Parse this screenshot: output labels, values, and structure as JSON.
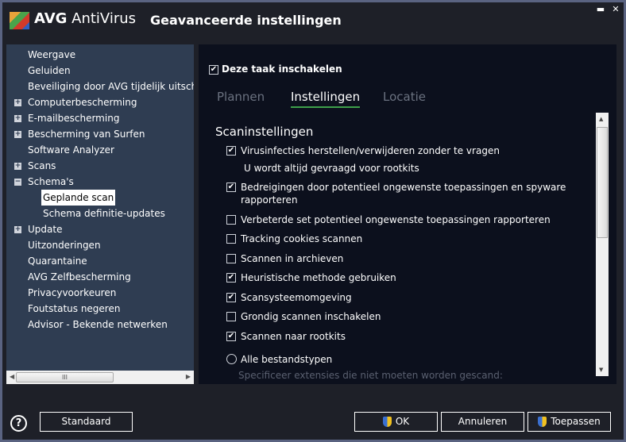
{
  "window": {
    "brand_bold": "AVG",
    "brand": " AntiVirus",
    "title": "Geavanceerde instellingen",
    "minimize": "▬",
    "close": "✕"
  },
  "sidebar": {
    "items": [
      {
        "label": "Weergave"
      },
      {
        "label": "Geluiden"
      },
      {
        "label": "Beveiliging door AVG tijdelijk uitschakelen"
      },
      {
        "label": "Computerbescherming",
        "expander": "+"
      },
      {
        "label": "E-mailbescherming",
        "expander": "+"
      },
      {
        "label": "Bescherming van Surfen",
        "expander": "+"
      },
      {
        "label": "Software Analyzer"
      },
      {
        "label": "Scans",
        "expander": "+"
      },
      {
        "label": "Schema's",
        "expander": "−"
      },
      {
        "label": "Geplande scan",
        "selected": true
      },
      {
        "label": "Schema definitie-updates"
      },
      {
        "label": "Update",
        "expander": "+"
      },
      {
        "label": "Uitzonderingen"
      },
      {
        "label": "Quarantaine"
      },
      {
        "label": "AVG Zelfbescherming"
      },
      {
        "label": "Privacyvoorkeuren"
      },
      {
        "label": "Foutstatus negeren"
      },
      {
        "label": "Advisor - Bekende netwerken"
      }
    ],
    "scroll_thumb": "III"
  },
  "content": {
    "enable_label": "Deze taak inschakelen",
    "enable_checked": true,
    "tabs": [
      {
        "label": "Plannen"
      },
      {
        "label": "Instellingen",
        "active": true
      },
      {
        "label": "Locatie"
      }
    ],
    "section_title": "Scaninstellingen",
    "options": [
      {
        "label": "Virusinfecties herstellen/verwijderen zonder te vragen",
        "checked": true
      },
      {
        "label": "Bedreigingen door potentieel ongewenste toepassingen en spyware",
        "label2": "rapporteren",
        "checked": true
      },
      {
        "label": "Verbeterde set potentieel ongewenste toepassingen rapporteren",
        "checked": false
      },
      {
        "label": "Tracking cookies scannen",
        "checked": false
      },
      {
        "label": "Scannen in archieven",
        "checked": false
      },
      {
        "label": "Heuristische methode gebruiken",
        "checked": true
      },
      {
        "label": "Scansysteemomgeving",
        "checked": true
      },
      {
        "label": "Grondig scannen inschakelen",
        "checked": false
      },
      {
        "label": "Scannen naar rootkits",
        "checked": true
      }
    ],
    "note": "U wordt altijd gevraagd voor rootkits",
    "radio_label": "Alle bestandstypen",
    "faded_text": "Specificeer extensies die niet moeten worden gescand:"
  },
  "footer": {
    "help": "?",
    "standard": "Standaard",
    "ok": "OK",
    "cancel": "Annuleren",
    "apply": "Toepassen"
  },
  "colors": {
    "accent": "#3ea04a",
    "sidebar": "#2f3d52",
    "content": "#0c101d"
  }
}
